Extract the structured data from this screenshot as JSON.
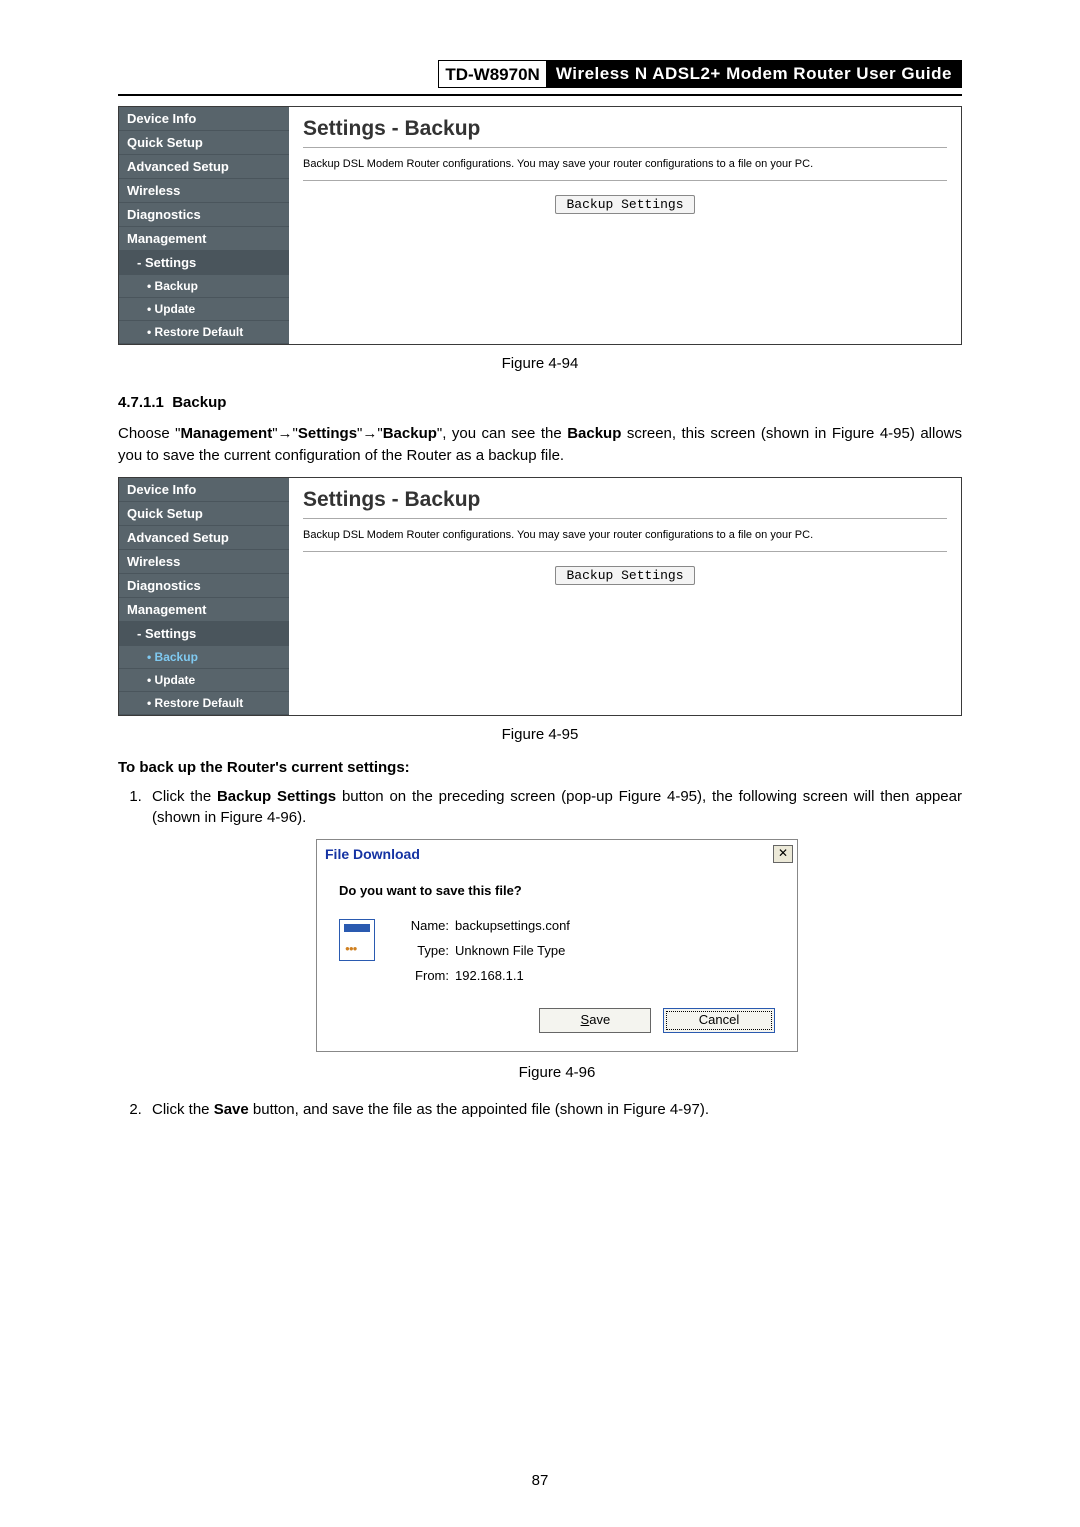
{
  "header": {
    "model": "TD-W8970N",
    "title": "Wireless N ADSL2+ Modem Router User Guide"
  },
  "sidebar_items": [
    "Device Info",
    "Quick Setup",
    "Advanced Setup",
    "Wireless",
    "Diagnostics",
    "Management"
  ],
  "sidebar_sub": {
    "settings": "Settings",
    "backup": "Backup",
    "update": "Update",
    "restore": "Restore Default"
  },
  "panel": {
    "title": "Settings - Backup",
    "desc": "Backup DSL Modem Router configurations. You may save your router configurations to a file on your PC.",
    "button": "Backup Settings"
  },
  "captions": {
    "fig94": "Figure 4-94",
    "fig95": "Figure 4-95",
    "fig96": "Figure 4-96"
  },
  "section": {
    "num": "4.7.1.1",
    "name": "Backup",
    "para_prefix": "Choose \"",
    "para_m": "Management",
    "para_s": "Settings",
    "para_b": "Backup",
    "para_mid": "\", you can see the ",
    "para_bold2": "Backup",
    "para_suffix": " screen, this screen (shown in Figure 4-95) allows you to save the current configuration of the Router as a backup file."
  },
  "instr": {
    "heading": "To back up the Router's current settings:",
    "step1_a": "Click the ",
    "step1_bold": "Backup Settings",
    "step1_b": " button on the preceding screen (pop-up Figure 4-95), the following screen will then appear (shown in Figure 4-96).",
    "step2_a": "Click the ",
    "step2_bold": "Save",
    "step2_b": " button, and save the file as the appointed file (shown in Figure 4-97)."
  },
  "dialog": {
    "title": "File Download",
    "question": "Do you want to save this file?",
    "name_label": "Name:",
    "name_value": "backupsettings.conf",
    "type_label": "Type:",
    "type_value": "Unknown File Type",
    "from_label": "From:",
    "from_value": "192.168.1.1",
    "save_prefix": "S",
    "save_rest": "ave",
    "cancel": "Cancel"
  },
  "page_number": "87"
}
